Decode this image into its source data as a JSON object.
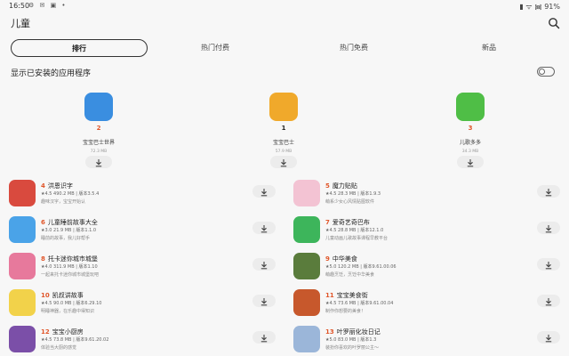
{
  "status": {
    "time": "16:50",
    "left_icons": "⚙ ✉ ▣ •",
    "right_icons": "▮ ᯤ ᯼ 91%"
  },
  "header": {
    "title": "儿童",
    "search_icon": "search-icon"
  },
  "tabs": [
    {
      "label": "排行",
      "active": true
    },
    {
      "label": "热门付费",
      "active": false
    },
    {
      "label": "热门免费",
      "active": false
    },
    {
      "label": "新品",
      "active": false
    }
  ],
  "toggle": {
    "label": "显示已安装的应用程序",
    "on": false
  },
  "podium": [
    {
      "rank": "2",
      "name": "宝宝巴士世界",
      "size": "72.3 MB",
      "color": "#3a8ee0"
    },
    {
      "rank": "1",
      "name": "宝宝巴士",
      "size": "57.9 MB",
      "color": "#f0a92b"
    },
    {
      "rank": "3",
      "name": "儿歌多多",
      "size": "34.3 MB",
      "color": "#4fbe46"
    }
  ],
  "list": [
    {
      "rank": "4",
      "name": "洪恩识字",
      "meta": "★4.5 490.2 MB | 版本3.5.4",
      "desc": "趣味汉字，宝宝开始认",
      "color": "#d94a3e"
    },
    {
      "rank": "5",
      "name": "魔力贴贴",
      "meta": "★4.5 28.3 MB | 版本1.9.3",
      "desc": "萌系少女心风情贴图软件",
      "color": "#f3c3d3"
    },
    {
      "rank": "6",
      "name": "儿童睡前故事大全",
      "meta": "★3.0 21.9 MB | 版本1.1.0",
      "desc": "睡前的故事，我儿好帮手",
      "color": "#4aa3e8"
    },
    {
      "rank": "7",
      "name": "爱奇艺奇巴布",
      "meta": "★4.5 28.8 MB | 版本12.1.0",
      "desc": "儿童动画儿歌故事课程早教平台",
      "color": "#3db55b"
    },
    {
      "rank": "8",
      "name": "托卡迷你城市城堡",
      "meta": "★4.0 311.9 MB | 版本1.10",
      "desc": "一起来托卡迷你城市城堡玩吧",
      "color": "#e7799c"
    },
    {
      "rank": "9",
      "name": "中华美食",
      "meta": "★5.0 120.2 MB | 版本9.61.00.06",
      "desc": "萌趣烹饪，烹饪中华美食",
      "color": "#5a7c3c"
    },
    {
      "rank": "10",
      "name": "凯叔讲故事",
      "meta": "★4.5 90.0 MB | 版本6.29.10",
      "desc": "明睡神器，在乐趣中得知识",
      "color": "#f2d24a"
    },
    {
      "rank": "11",
      "name": "宝宝美食街",
      "meta": "★4.5 73.6 MB | 版本9.61.00.04",
      "desc": "制作你想要的美食！",
      "color": "#c7582c"
    },
    {
      "rank": "12",
      "name": "宝宝小厨房",
      "meta": "★4.5 73.8 MB | 版本9.61.20.02",
      "desc": "体验当大厨的感觉",
      "color": "#7b4fa8"
    },
    {
      "rank": "13",
      "name": "叶罗丽化妆日记",
      "meta": "★5.0 83.0 MB | 版本1.3",
      "desc": "装扮你喜欢的叶罗丽公主～",
      "color": "#9bb6d9"
    }
  ]
}
